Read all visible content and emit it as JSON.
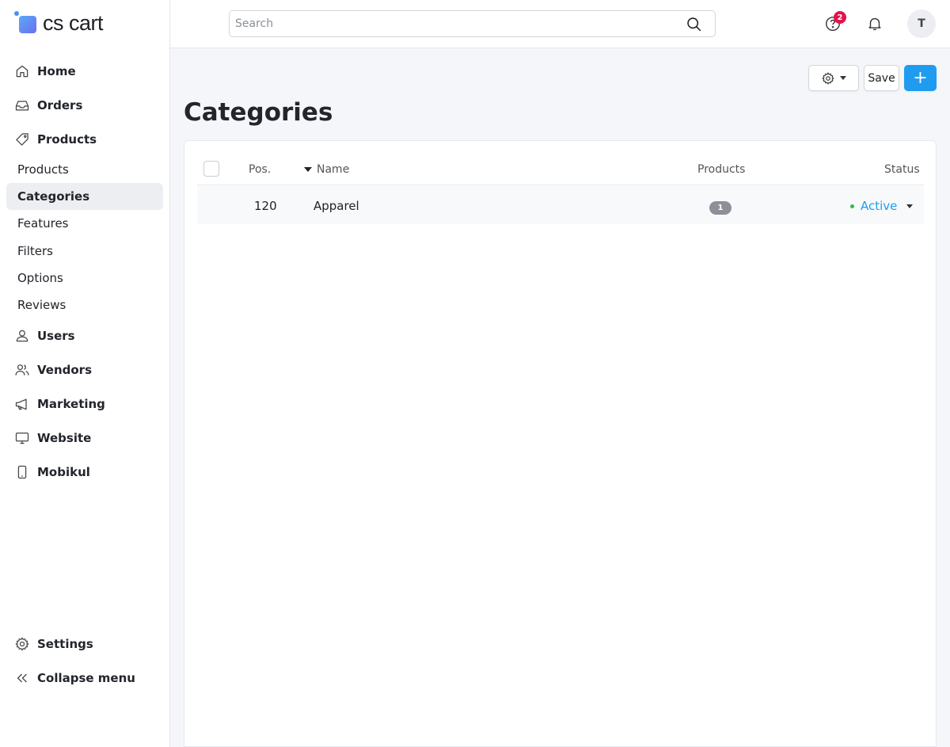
{
  "app": {
    "logo_text": "cs cart"
  },
  "sidebar": {
    "items": [
      {
        "label": "Home",
        "icon": "home-icon"
      },
      {
        "label": "Orders",
        "icon": "inbox-icon"
      },
      {
        "label": "Products",
        "icon": "tag-icon"
      },
      {
        "label": "Users",
        "icon": "user-icon"
      },
      {
        "label": "Vendors",
        "icon": "users-icon"
      },
      {
        "label": "Marketing",
        "icon": "megaphone-icon"
      },
      {
        "label": "Website",
        "icon": "monitor-icon"
      },
      {
        "label": "Mobikul",
        "icon": "phone-icon"
      }
    ],
    "sub_items": [
      "Products",
      "Categories",
      "Features",
      "Filters",
      "Options",
      "Reviews"
    ],
    "active_sub_item": "Categories",
    "footer": [
      {
        "label": "Settings",
        "icon": "gear-icon"
      },
      {
        "label": "Collapse menu",
        "icon": "double-chevron-left-icon"
      }
    ]
  },
  "topbar": {
    "search_placeholder": "Search",
    "help_badge": "2",
    "avatar_initial": "T"
  },
  "toolbar": {
    "save_label": "Save",
    "add_label": "+"
  },
  "page": {
    "title": "Categories"
  },
  "table": {
    "headers": {
      "pos": "Pos.",
      "name": "Name",
      "products": "Products",
      "status": "Status"
    },
    "rows": [
      {
        "pos": "120",
        "name": "Apparel",
        "products": "1",
        "status": "Active"
      }
    ]
  },
  "colors": {
    "accent": "#1f9cf0",
    "badge": "#e2124b",
    "status_dot": "#2dbb4f"
  }
}
